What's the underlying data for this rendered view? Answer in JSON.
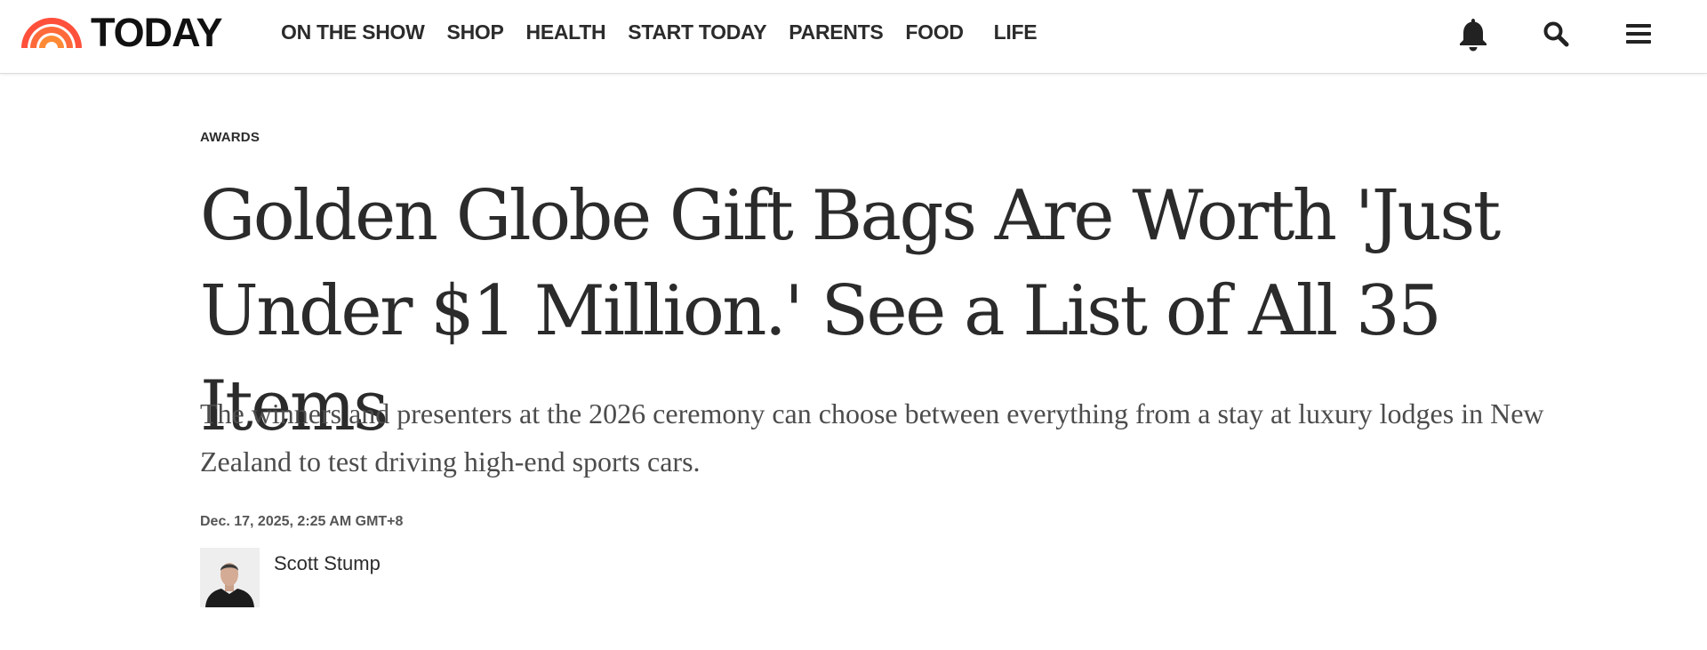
{
  "header": {
    "logo_text": "TODAY",
    "logo_color": "#ff503c",
    "nav": [
      {
        "label": "ON THE SHOW"
      },
      {
        "label": "SHOP"
      },
      {
        "label": "HEALTH"
      },
      {
        "label": "START TODAY"
      },
      {
        "label": "PARENTS"
      },
      {
        "label": "FOOD"
      },
      {
        "label": "LIFE"
      }
    ],
    "icons": [
      "bell-icon",
      "search-icon",
      "menu-icon"
    ]
  },
  "article": {
    "category": "AWARDS",
    "headline": "Golden Globe Gift Bags Are Worth 'Just Under $1 Million.' See a List of All 35 Items",
    "dek": "The winners and presenters at the 2026 ceremony can choose between everything from a stay at luxury lodges in New Zealand to test driving high-end sports cars.",
    "timestamp": "Dec. 17, 2025, 2:25 AM GMT+8",
    "author": "Scott Stump"
  }
}
